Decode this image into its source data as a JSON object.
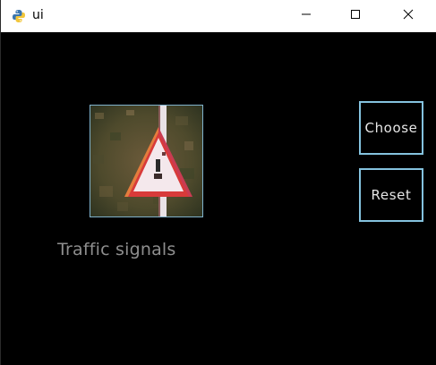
{
  "window": {
    "title": "ui",
    "app_icon": "python-icon"
  },
  "controls": {
    "minimize_icon": "minimize-icon",
    "maximize_icon": "maximize-icon",
    "close_icon": "close-icon"
  },
  "main": {
    "image_label": "Traffic signals",
    "image_subject": "warning-triangle-sign",
    "choose_label": "Choose",
    "reset_label": "Reset"
  },
  "colors": {
    "background": "#000000",
    "button_border": "#85c3df",
    "image_border": "#7fb2cc",
    "caption_text": "#8e8e8e"
  }
}
